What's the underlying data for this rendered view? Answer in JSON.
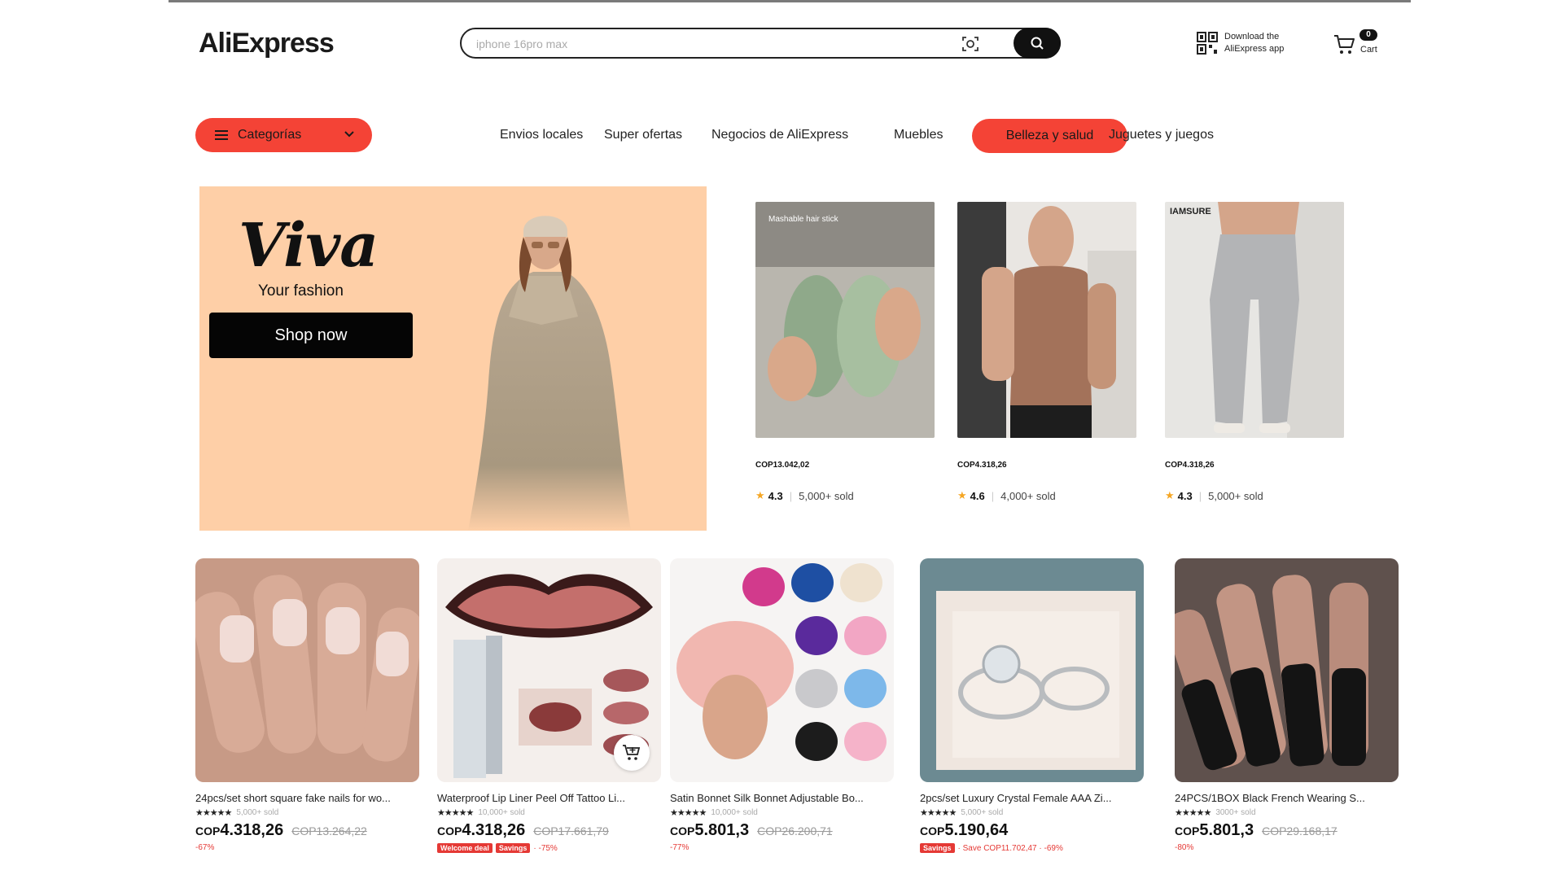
{
  "header": {
    "logo": "AliExpress",
    "search_placeholder": "iphone 16pro max",
    "app_download": "Download the AliExpress app",
    "cart_count": "0",
    "cart_label": "Cart"
  },
  "nav": {
    "categories_label": "Categorías",
    "links": [
      "Envios locales",
      "Super ofertas",
      "Negocios de AliExpress",
      "Muebles"
    ],
    "active_link": "Belleza y salud",
    "last_link": "Juguetes y juegos"
  },
  "hero": {
    "brand": "Viva",
    "tagline": "Your fashion",
    "button": "Shop now",
    "background_color": "#fecfa7"
  },
  "featured": [
    {
      "image_caption": "Mashable hair stick",
      "price": "COP13.042,02",
      "rating": "4.3",
      "sold": "5,000+ sold"
    },
    {
      "image_caption": "",
      "price": "COP4.318,26",
      "rating": "4.6",
      "sold": "4,000+ sold"
    },
    {
      "image_caption": "IAMSURE",
      "price": "COP4.318,26",
      "rating": "4.3",
      "sold": "5,000+ sold"
    }
  ],
  "products": [
    {
      "title": "24pcs/set short square fake nails for wo...",
      "sold": "5,000+ sold",
      "currency": "COP",
      "price": "4.318,26",
      "original": "COP13.264,22",
      "promo_tags": [],
      "promo_text": "-67%"
    },
    {
      "title": "Waterproof Lip Liner Peel Off Tattoo Li...",
      "sold": "10,000+ sold",
      "currency": "COP",
      "price": "4.318,26",
      "original": "COP17.661,79",
      "promo_tags": [
        "Welcome deal",
        "Savings"
      ],
      "promo_text": "· -75%"
    },
    {
      "title": "Satin Bonnet Silk Bonnet Adjustable Bo...",
      "sold": "10,000+ sold",
      "currency": "COP",
      "price": "5.801,3",
      "original": "COP26.200,71",
      "promo_tags": [],
      "promo_text": "-77%"
    },
    {
      "title": "2pcs/set Luxury Crystal Female AAA Zi...",
      "sold": "5,000+ sold",
      "currency": "COP",
      "price": "5.190,64",
      "original": "",
      "promo_tags": [
        "Savings"
      ],
      "promo_text": "· Save COP11.702,47 · -69%"
    },
    {
      "title": "24PCS/1BOX Black French Wearing S...",
      "sold": "3000+ sold",
      "currency": "COP",
      "price": "5.801,3",
      "original": "COP29.168,17",
      "promo_tags": [],
      "promo_text": "-80%"
    }
  ],
  "colors": {
    "accent_red": "#f44336",
    "promo_red": "#e53935",
    "black": "#111111"
  },
  "icons": [
    "image-search-icon",
    "search-icon",
    "qr-code-icon",
    "cart-icon",
    "menu-icon",
    "chevron-down-icon",
    "star-icon",
    "add-to-cart-icon"
  ]
}
